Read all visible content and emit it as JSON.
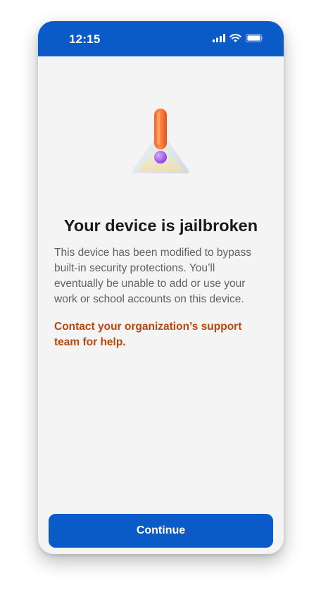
{
  "status_bar": {
    "time": "12:15",
    "icons": [
      "signal-icon",
      "wifi-icon",
      "battery-icon"
    ],
    "background_color": "#0a5ac8"
  },
  "alert": {
    "icon": "warning-exclamation-icon",
    "title": "Your device is jailbroken",
    "description": "This device has been modified to bypass built-in security protections. You’ll eventually be unable to add or use your work or school accounts on this device.",
    "support_text": "Contact your organization’s support team for help.",
    "support_color": "#b4480d"
  },
  "actions": {
    "continue_label": "Continue",
    "accent_color": "#0a5ac8"
  }
}
